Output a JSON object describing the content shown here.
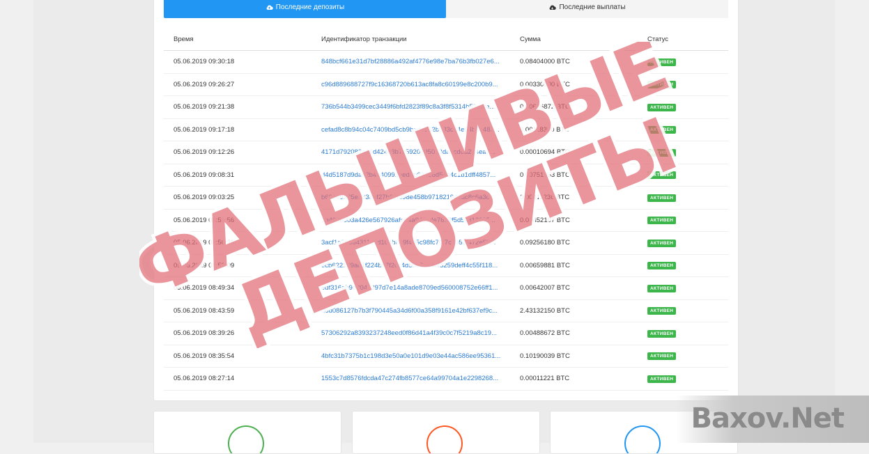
{
  "tabs": [
    {
      "label": "Последние депозиты",
      "icon": "cloud-upload-icon",
      "active": true
    },
    {
      "label": "Последние выплаты",
      "icon": "cloud-download-icon",
      "active": false
    }
  ],
  "table": {
    "headers": [
      "Время",
      "Идентификатор транзакции",
      "Сумма",
      "Статус"
    ],
    "rows": [
      {
        "time": "05.06.2019 09:30:18",
        "tx": "848bcf661e31d7bf28886a492af4776e98e7ba76b3fb027e6...",
        "amount": "0.08404000 BTC",
        "status": "АКТИВЕН"
      },
      {
        "time": "05.06.2019 09:26:27",
        "tx": "c96d889688727f9c16368720b613ac8fa8c60199e8c200b9...",
        "amount": "0.00330000 BTC",
        "status": "АКТИВЕН"
      },
      {
        "time": "05.06.2019 09:21:38",
        "tx": "736b544b3499cec3449f6bfd2823f89c8a3f8f5314b53e3fe...",
        "amount": "0.00636872 BTC",
        "status": "АКТИВЕН"
      },
      {
        "time": "05.06.2019 09:17:18",
        "tx": "cefad8c8b94c04c7409bd5cb9baded52b533c24e04b6e482...",
        "amount": "0.00118300 BTC",
        "status": "АКТИВЕН"
      },
      {
        "time": "05.06.2019 09:12:26",
        "tx": "4171d792083a46d424d3b7c5920795013da9cded274ea7...",
        "amount": "0.00010694 BTC",
        "status": "АКТИВЕН"
      },
      {
        "time": "05.06.2019 09:08:31",
        "tx": "d4d5187d9dad2b4a40992eed6b633e6d54b4c1b1dff4857...",
        "amount": "0.00751953 BTC",
        "status": "АКТИВЕН"
      },
      {
        "time": "05.06.2019 09:03:25",
        "tx": "b606e9a85e5338af27b62f398e458b971821943dc8c6a3d...",
        "amount": "0.00411236 BTC",
        "status": "АКТИВЕН"
      },
      {
        "time": "05.06.2019 08:59:56",
        "tx": "3b4036003a426e567926afe04a943cde7613f5d5c812895...",
        "amount": "0.00452107 BTC",
        "status": "АКТИВЕН"
      },
      {
        "time": "05.06.2019 08:56:35",
        "tx": "3acf1a26564311c5d104b849f4d5c98fc70f7c7052f472e5b...",
        "amount": "0.09256180 BTC",
        "status": "АКТИВЕН"
      },
      {
        "time": "05.06.2019 08:53:09",
        "tx": "ecb6221d9ad1f224b97f2cc4d5be8ae4af3259deff4c55f118...",
        "amount": "0.00659881 BTC",
        "status": "АКТИВЕН"
      },
      {
        "time": "05.06.2019 08:49:34",
        "tx": "edf316eb9e2041397d7e14a8ade8709ed560008752e66ff1...",
        "amount": "0.00642007 BTC",
        "status": "АКТИВЕН"
      },
      {
        "time": "05.06.2019 08:43:59",
        "tx": "d6d086127b7b3f790445a34d6f00a358f9161e42bf637ef9c...",
        "amount": "2.43132150 BTC",
        "status": "АКТИВЕН"
      },
      {
        "time": "05.06.2019 08:39:26",
        "tx": "57306292a8393237248eed0f86d41a4f39c0c7f5219a8c19...",
        "amount": "0.00488672 BTC",
        "status": "АКТИВЕН"
      },
      {
        "time": "05.06.2019 08:35:54",
        "tx": "4bfc31b7375b1c198d3e50a0e101d9e03e44ac586ee95361...",
        "amount": "0.10190039 BTC",
        "status": "АКТИВЕН"
      },
      {
        "time": "05.06.2019 08:27:14",
        "tx": "1553c7d8576fdcda47c274fb8577ce64a99704a1e2298268...",
        "amount": "0.00011221 BTC",
        "status": "АКТИВЕН"
      }
    ]
  },
  "watermark": {
    "line1": "ФАЛЬШИВЫЕ",
    "line2": "ДЕПОЗИТЫ"
  },
  "brand": {
    "text": "Baxov.Net"
  },
  "features": [
    {
      "icon": "clipboard-icon",
      "color": "#4caf50"
    },
    {
      "icon": "stopwatch-icon",
      "color": "#ff5722"
    },
    {
      "icon": "monitor-icon",
      "color": "#2196f3"
    }
  ],
  "colors": {
    "accent": "#2196f3",
    "link": "#2a7bd3",
    "badge": "#3cb54a",
    "stamp": "#e0787e"
  }
}
